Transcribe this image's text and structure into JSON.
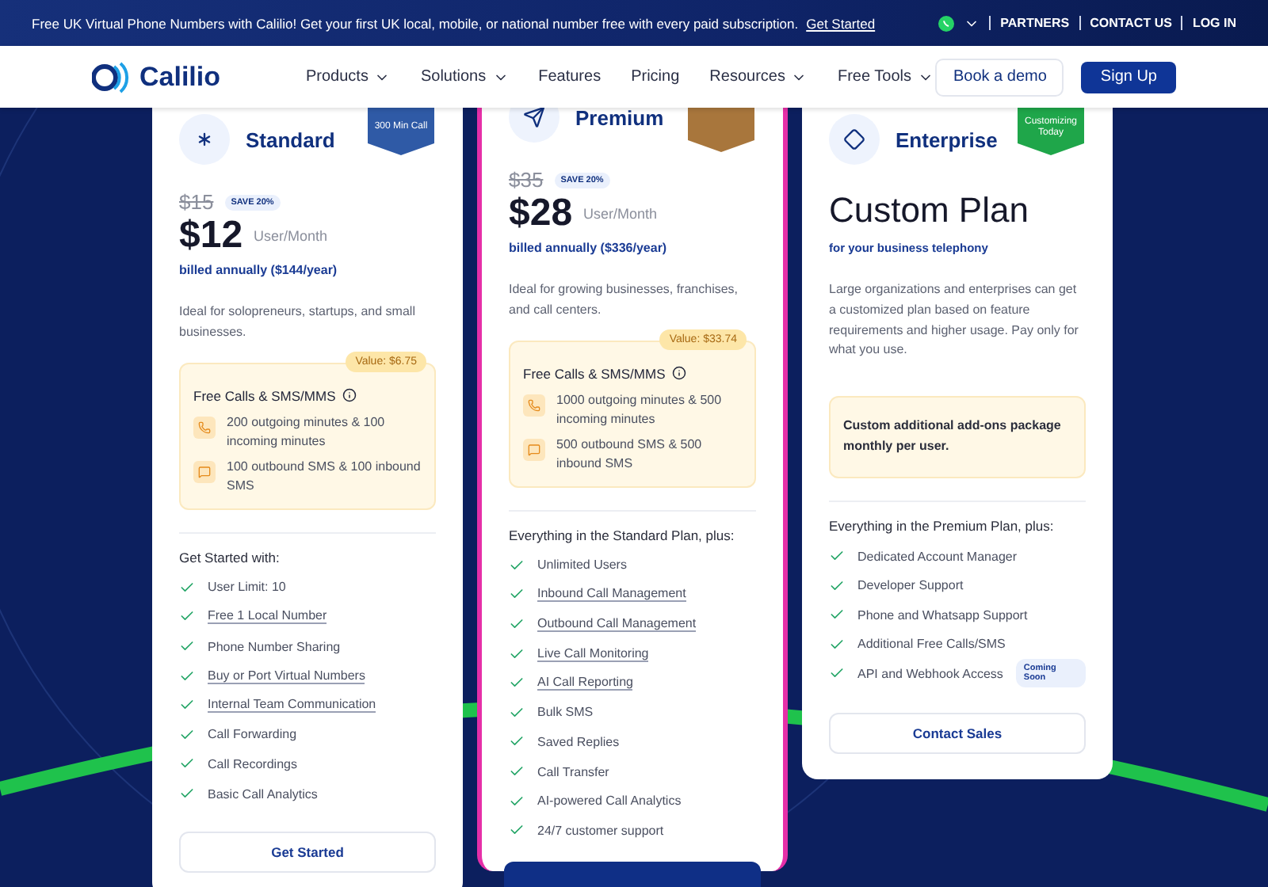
{
  "banner": {
    "text": "Free UK Virtual Phone Numbers with Calilio! Get your first UK local, mobile, or national number free with every paid subscription.",
    "link": "Get Started",
    "links": [
      "PARTNERS",
      "CONTACT US",
      "LOG IN"
    ]
  },
  "nav": {
    "logo": "Calilio",
    "items": [
      {
        "label": "Products",
        "dropdown": true
      },
      {
        "label": "Solutions",
        "dropdown": true
      },
      {
        "label": "Features",
        "dropdown": false
      },
      {
        "label": "Pricing",
        "dropdown": false
      },
      {
        "label": "Resources",
        "dropdown": true
      },
      {
        "label": "Free Tools",
        "dropdown": true
      }
    ],
    "demo": "Book a demo",
    "signup": "Sign Up"
  },
  "plans": [
    {
      "name": "Standard",
      "highlighted": false,
      "ribbon": {
        "text": "300 Min Call",
        "color": "#2f5aa6"
      },
      "old_price": "$15",
      "save": "SAVE 20%",
      "price": "$12",
      "unit": "User/Month",
      "billing": "billed annually ($144/year)",
      "description": "Ideal for solopreneurs, startups, and small businesses.",
      "value_box": {
        "value": "Value: $6.75",
        "title": "Free Calls & SMS/MMS",
        "items": [
          {
            "kind": "call",
            "text": "200 outgoing minutes & 100 incoming minutes"
          },
          {
            "kind": "sms",
            "text": "100 outbound SMS & 100 inbound SMS"
          }
        ]
      },
      "features_title": "Get Started with:",
      "features": [
        {
          "text": "User Limit: 10",
          "underlined": false
        },
        {
          "text": "Free 1 Local Number",
          "underlined": true
        },
        {
          "text": "Phone Number Sharing",
          "underlined": false
        },
        {
          "text": "Buy or Port Virtual Numbers",
          "underlined": true
        },
        {
          "text": "Internal Team Communication",
          "underlined": true
        },
        {
          "text": "Call Forwarding",
          "underlined": false
        },
        {
          "text": "Call Recordings",
          "underlined": false
        },
        {
          "text": "Basic Call Analytics",
          "underlined": false
        }
      ],
      "cta": {
        "kind": "outline",
        "label": "Get Started"
      }
    },
    {
      "name": "Premium",
      "highlighted": true,
      "ribbon": {
        "color": "#a8763c"
      },
      "old_price": "$35",
      "save": "SAVE 20%",
      "price": "$28",
      "unit": "User/Month",
      "billing": "billed annually ($336/year)",
      "description": "Ideal for growing businesses, franchises, and call centers.",
      "value_box": {
        "value": "Value: $33.74",
        "title": "Free Calls & SMS/MMS",
        "items": [
          {
            "kind": "call",
            "text": "1000 outgoing minutes & 500 incoming minutes"
          },
          {
            "kind": "sms",
            "text": "500 outbound SMS & 500 inbound SMS"
          }
        ]
      },
      "features_title": "Everything in the Standard Plan, plus:",
      "features": [
        {
          "text": "Unlimited Users",
          "underlined": false
        },
        {
          "text": "Inbound Call Management",
          "underlined": true
        },
        {
          "text": "Outbound Call Management",
          "underlined": true
        },
        {
          "text": "Live Call Monitoring",
          "underlined": true
        },
        {
          "text": "AI Call Reporting",
          "underlined": true
        },
        {
          "text": "Bulk SMS",
          "underlined": false
        },
        {
          "text": "Saved Replies",
          "underlined": false
        },
        {
          "text": "Call Transfer",
          "underlined": false
        },
        {
          "text": "AI-powered Call Analytics",
          "underlined": false
        },
        {
          "text": "24/7 customer support",
          "underlined": false
        }
      ],
      "cta": {
        "kind": "filled"
      }
    },
    {
      "name": "Enterprise",
      "highlighted": false,
      "ribbon": {
        "text": "Customizing Today",
        "color": "#1fa64a"
      },
      "headline": "Custom Plan",
      "subline": "for your business telephony",
      "description": "Large organizations and enterprises can get a customized plan based on feature requirements and higher usage. Pay only for what you use.",
      "note": "Custom additional add-ons package monthly per user.",
      "features_title": "Everything in the Premium Plan, plus:",
      "features": [
        {
          "text": "Dedicated Account Manager",
          "underlined": false
        },
        {
          "text": "Developer Support",
          "underlined": false
        },
        {
          "text": "Phone and Whatsapp Support",
          "underlined": false
        },
        {
          "text": "Additional Free Calls/SMS",
          "underlined": false
        },
        {
          "text": "API and Webhook Access",
          "underlined": false,
          "badge": "Coming Soon"
        }
      ],
      "cta": {
        "kind": "outline",
        "label": "Contact Sales"
      }
    }
  ]
}
